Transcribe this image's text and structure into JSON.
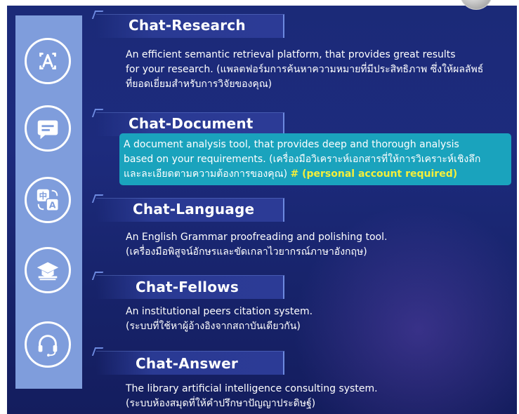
{
  "sections": [
    {
      "title": "Chat-Research",
      "lines": [
        "An efficient semantic retrieval platform, that provides great results",
        "for your research. (แพลตฟอร์มการค้นหาความหมายที่มีประสิทธิภาพ ซึ่งให้ผลลัพธ์",
        "ที่ยอดเยี่ยมสำหรับการวิจัยของคุณ)"
      ]
    },
    {
      "title": "Chat-Document",
      "lines": [
        "A document analysis tool, that provides deep and thorough analysis",
        "based on your requirements. (เครื่องมือวิเคราะห์เอกสารที่ให้การวิเคราะห์เชิงลึก",
        "และละเอียดตามความต้องการของคุณ)"
      ],
      "note": "# (personal account required)"
    },
    {
      "title": "Chat-Language",
      "lines": [
        "An English Grammar proofreading and polishing tool.",
        "(เครื่องมือพิสูจน์อักษรและขัดเกลาไวยากรณ์ภาษาอังกฤษ)"
      ]
    },
    {
      "title": "Chat-Fellows",
      "lines": [
        "An institutional peers citation system.",
        "(ระบบที่ใช้หาผู้อ้างอิงจากสถาบันเดียวกัน)"
      ]
    },
    {
      "title": "Chat-Answer",
      "lines": [
        "The library artificial intelligence consulting system.",
        "(ระบบห้องสมุดที่ให้คำปรึกษาปัญญาประดิษฐ์)"
      ]
    }
  ],
  "icons": [
    "ai-text-icon",
    "chat-bubble-icon",
    "translate-icon",
    "graduation-cap-icon",
    "headset-icon"
  ],
  "colors": {
    "background": "#1b2a78",
    "sidebar": "#7f9ddc",
    "highlight": "#1aa3bd",
    "note": "#f5ef3a"
  }
}
